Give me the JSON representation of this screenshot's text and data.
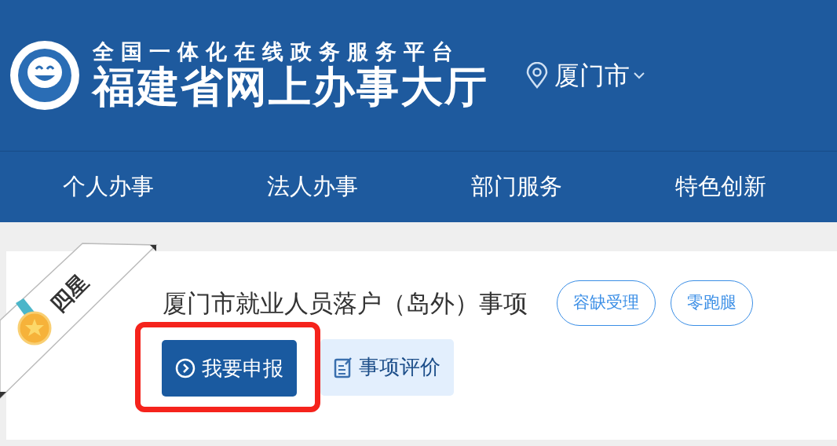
{
  "header": {
    "platform_subtitle": "全国一体化在线政务服务平台",
    "site_title": "福建省网上办事大厅",
    "location": {
      "city": "厦门市"
    }
  },
  "nav": [
    {
      "label": "个人办事"
    },
    {
      "label": "法人办事"
    },
    {
      "label": "部门服务"
    },
    {
      "label": "特色创新"
    }
  ],
  "service": {
    "rating_ribbon": "四星",
    "title": "厦门市就业人员落户（岛外）事项",
    "tags": [
      "容缺受理",
      "零跑腿"
    ],
    "actions": [
      {
        "label": "我要申报",
        "kind": "primary",
        "highlighted": true
      },
      {
        "label": "事项评价",
        "kind": "secondary",
        "highlighted": false
      }
    ]
  }
}
